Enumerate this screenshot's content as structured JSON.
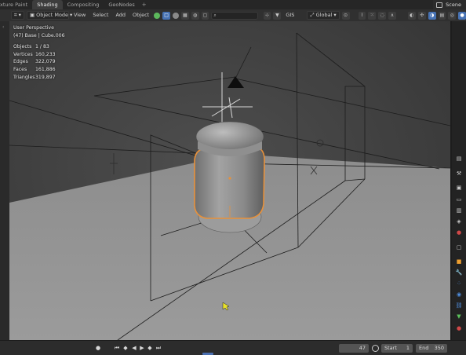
{
  "tabs": [
    {
      "label": "xture Paint",
      "active": false
    },
    {
      "label": "Shading",
      "active": true
    },
    {
      "label": "Compositing",
      "active": false
    },
    {
      "label": "GeoNodes",
      "active": false
    }
  ],
  "tab_add": "+",
  "scene_label": "Scene",
  "header": {
    "mode": "Object Mode",
    "menus": {
      "view": "View",
      "select": "Select",
      "add": "Add",
      "object": "Object"
    },
    "gis": "GIS",
    "orientation": "Global",
    "search_placeholder": ""
  },
  "viewport": {
    "perspective": "User Perspective",
    "context": "(47) Base | Cube.006",
    "stats": [
      {
        "label": "Objects",
        "value": "1 / 83"
      },
      {
        "label": "Vertices",
        "value": "160,233"
      },
      {
        "label": "Edges",
        "value": "322,079"
      },
      {
        "label": "Faces",
        "value": "161,886"
      },
      {
        "label": "Triangles",
        "value": "319,897"
      }
    ]
  },
  "timeline": {
    "current_frame": "47",
    "start_label": "Start",
    "start_value": "1",
    "end_label": "End",
    "end_value": "350"
  },
  "colors": {
    "selection_outline": "#e8913a",
    "accent": "#4772b3",
    "floor": "#8e8e8e",
    "background": "#3f3f3f"
  }
}
